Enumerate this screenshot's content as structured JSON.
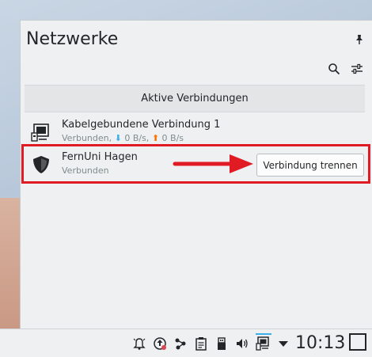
{
  "popup": {
    "title": "Netzwerke",
    "section_header": "Aktive Verbindungen"
  },
  "connections": [
    {
      "name": "Kabelgebundene Verbindung 1",
      "status": "Verbunden,",
      "down_rate": "0 B/s,",
      "up_rate": "0 B/s",
      "icon": "wired-network-icon"
    },
    {
      "name": "FernUni Hagen",
      "status": "Verbunden",
      "icon": "vpn-shield-icon",
      "action_label": "Verbindung trennen"
    }
  ],
  "taskbar": {
    "clock": "10:13",
    "icons": [
      "notifications-icon",
      "updates-icon",
      "kde-connect-icon",
      "clipboard-icon",
      "usb-device-icon",
      "volume-icon",
      "network-icon",
      "expand-tray-icon"
    ]
  },
  "colors": {
    "highlight": "#e01b24",
    "download_arrow": "#3daee9",
    "upload_arrow": "#f67400"
  }
}
